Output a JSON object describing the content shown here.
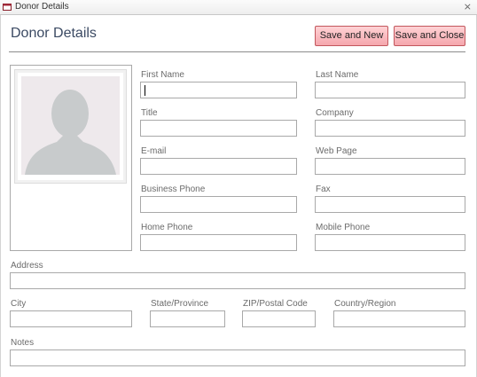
{
  "window": {
    "title": "Donor Details",
    "close_glyph": "⨯"
  },
  "header": {
    "title": "Donor Details",
    "save_new_label": "Save and New",
    "save_close_label": "Save and Close"
  },
  "photo": {
    "icon": "person-silhouette-icon"
  },
  "fields": {
    "first_name": {
      "label": "First Name",
      "value": ""
    },
    "last_name": {
      "label": "Last Name",
      "value": ""
    },
    "title": {
      "label": "Title",
      "value": ""
    },
    "company": {
      "label": "Company",
      "value": ""
    },
    "email": {
      "label": "E-mail",
      "value": ""
    },
    "web_page": {
      "label": "Web Page",
      "value": ""
    },
    "business_phone": {
      "label": "Business Phone",
      "value": ""
    },
    "fax": {
      "label": "Fax",
      "value": ""
    },
    "home_phone": {
      "label": "Home Phone",
      "value": ""
    },
    "mobile_phone": {
      "label": "Mobile Phone",
      "value": ""
    },
    "address": {
      "label": "Address",
      "value": ""
    },
    "city": {
      "label": "City",
      "value": ""
    },
    "state": {
      "label": "State/Province",
      "value": ""
    },
    "zip": {
      "label": "ZIP/Postal Code",
      "value": ""
    },
    "country": {
      "label": "Country/Region",
      "value": ""
    },
    "notes": {
      "label": "Notes",
      "value": ""
    }
  },
  "colors": {
    "button_fill": "#f5a7ad",
    "button_border": "#c2575d",
    "title_text": "#3b4a63"
  }
}
